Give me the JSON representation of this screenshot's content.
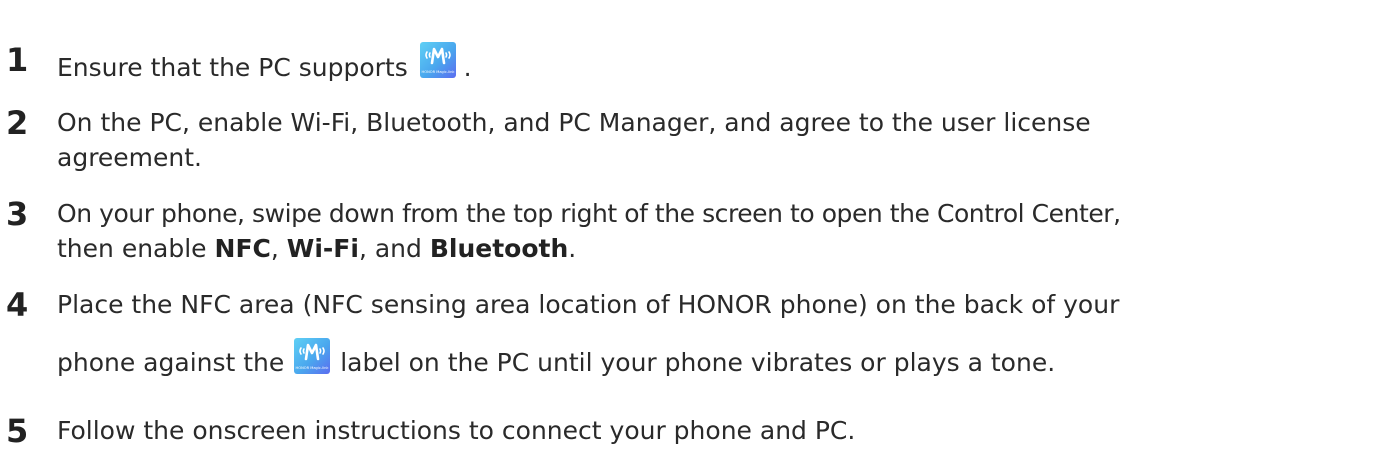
{
  "steps": [
    {
      "number": "1",
      "text_before": "Ensure that the PC supports",
      "text_after": "."
    },
    {
      "number": "2",
      "line1": "On the PC, enable Wi-Fi, Bluetooth, and PC Manager, and agree to the user license",
      "line2": "agreement."
    },
    {
      "number": "3",
      "line1": "On your phone, swipe down from the top right of the screen to open the Control Center,",
      "line2_prefix": "then enable",
      "bold1": "NFC",
      "sep1": ",",
      "bold2": "Wi-Fi",
      "sep2": ", and",
      "bold3": "Bluetooth",
      "end": "."
    },
    {
      "number": "4",
      "line1": "Place the NFC area (NFC sensing area location of HONOR phone) on the back of your",
      "line2_before": "phone against the",
      "line2_after": "label on the PC until your phone vibrates or plays a tone."
    },
    {
      "number": "5",
      "text": "Follow the onscreen instructions to connect your phone and PC."
    }
  ],
  "badge": {
    "caption": "HONOR Magic-link",
    "icon": "magic-link-icon",
    "colors": {
      "gradient_start": "#5fd0f5",
      "gradient_mid": "#4aa7ee",
      "gradient_end": "#5b6cf0",
      "glyph": "#ffffff"
    }
  }
}
